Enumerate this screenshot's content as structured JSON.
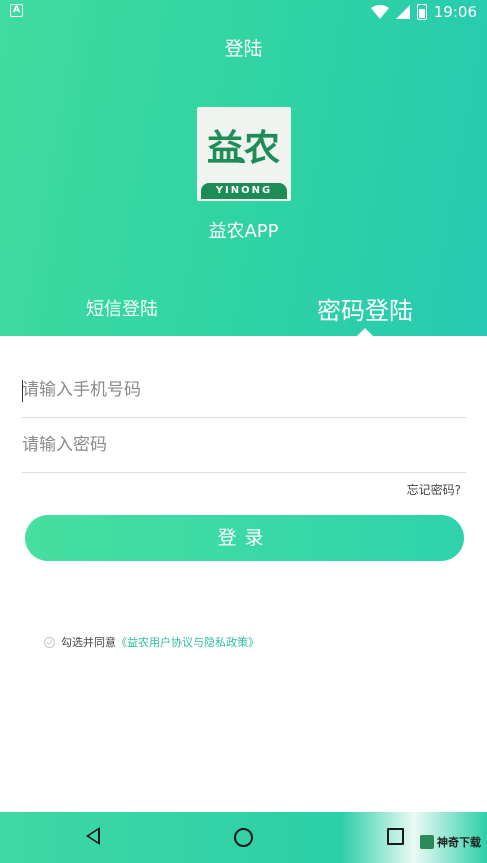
{
  "status_bar": {
    "time": "19:06",
    "notification_icon": "app-notification-icon",
    "icons": [
      "wifi-icon",
      "signal-icon",
      "battery-icon"
    ]
  },
  "header": {
    "title": "登陆"
  },
  "logo": {
    "text": "益农",
    "subtext": "YINONG"
  },
  "app_name": "益农APP",
  "tabs": [
    {
      "label": "短信登陆",
      "active": false
    },
    {
      "label": "密码登陆",
      "active": true
    }
  ],
  "form": {
    "phone_placeholder": "请输入手机号码",
    "password_placeholder": "请输入密码",
    "forgot_label": "忘记密码?",
    "login_label": "登录"
  },
  "agreement": {
    "prefix": "勾选并同意",
    "link": "《益农用户协议与隐私政策》"
  },
  "watermark": {
    "text": "神奇下载"
  },
  "colors": {
    "primary": "#2fd3a3",
    "primary_light": "#46dfa0",
    "link": "#2fbfa0"
  }
}
